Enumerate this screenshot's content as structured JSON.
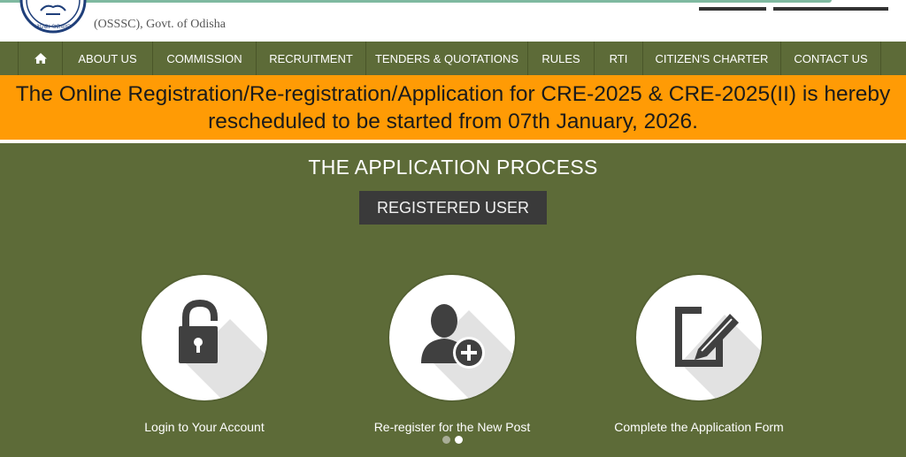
{
  "header": {
    "org_text": "(OSSSC), Govt. of Odisha",
    "logo_text": "ଓଡ଼ିଶା ସରକାର"
  },
  "nav": {
    "items": [
      {
        "label": "",
        "icon": "home-icon"
      },
      {
        "label": "ABOUT US"
      },
      {
        "label": "COMMISSION"
      },
      {
        "label": "RECRUITMENT"
      },
      {
        "label": "TENDERS & QUOTATIONS"
      },
      {
        "label": "RULES"
      },
      {
        "label": "RTI"
      },
      {
        "label": "CITIZEN'S CHARTER"
      },
      {
        "label": "CONTACT US"
      }
    ]
  },
  "banner": {
    "text": "The Online Registration/Re-registration/Application for CRE-2025 & CRE-2025(II) is hereby rescheduled to be started from 07th January, 2026."
  },
  "main": {
    "title": "THE APPLICATION PROCESS",
    "registered_user_label": "REGISTERED USER",
    "steps": [
      {
        "label": "Login to Your Account",
        "icon": "lock-icon"
      },
      {
        "label": "Re-register for the New Post",
        "icon": "add-user-icon"
      },
      {
        "label": "Complete the Application Form",
        "icon": "edit-form-icon"
      }
    ],
    "carousel": {
      "pages": 2,
      "active": 2
    }
  },
  "colors": {
    "nav_bg": "#5d6b38",
    "banner_bg": "#ff9b05",
    "button_bg": "#3a3a3a",
    "page_bg": "#5d6b38"
  }
}
